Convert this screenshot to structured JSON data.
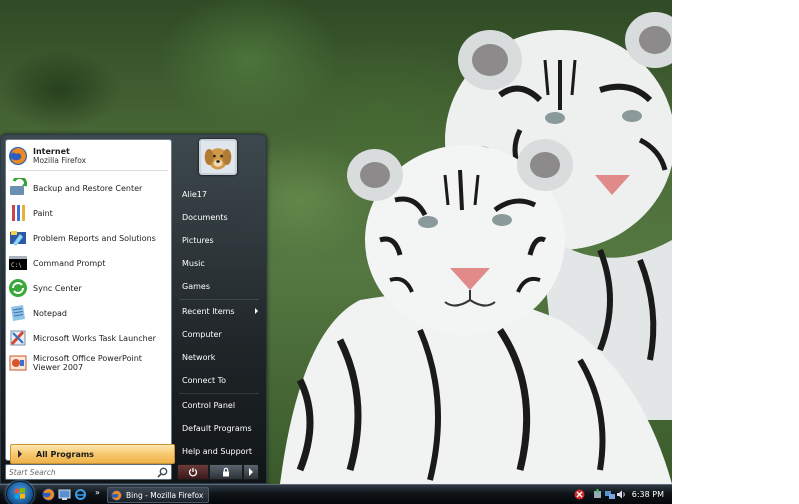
{
  "start_menu": {
    "pinned": {
      "title": "Internet",
      "subtitle": "Mozilla Firefox"
    },
    "programs": [
      {
        "label": "Backup and Restore Center",
        "icon": "backup-restore-icon"
      },
      {
        "label": "Paint",
        "icon": "paint-icon"
      },
      {
        "label": "Problem Reports and Solutions",
        "icon": "problem-reports-icon"
      },
      {
        "label": "Command Prompt",
        "icon": "command-prompt-icon"
      },
      {
        "label": "Sync Center",
        "icon": "sync-center-icon"
      },
      {
        "label": "Notepad",
        "icon": "notepad-icon"
      },
      {
        "label": "Microsoft Works Task Launcher",
        "icon": "works-task-launcher-icon"
      },
      {
        "label": "Microsoft Office PowerPoint Viewer 2007",
        "icon": "powerpoint-viewer-icon"
      }
    ],
    "all_programs_label": "All Programs",
    "search_placeholder": "Start Search",
    "right_items": [
      {
        "label": "Alie17"
      },
      {
        "label": "Documents"
      },
      {
        "label": "Pictures"
      },
      {
        "label": "Music"
      },
      {
        "label": "Games"
      },
      {
        "label": "Recent Items"
      },
      {
        "label": "Computer"
      },
      {
        "label": "Network"
      },
      {
        "label": "Connect To"
      },
      {
        "label": "Control Panel"
      },
      {
        "label": "Default Programs"
      },
      {
        "label": "Help and Support"
      }
    ]
  },
  "taskbar": {
    "task_firefox_label": "Bing - Mozilla Firefox",
    "clock": "6:38 PM"
  },
  "colors": {
    "menu_background": "#1e2228",
    "all_programs_highlight": "#f6c86e",
    "taskbar": "#0f1418"
  }
}
